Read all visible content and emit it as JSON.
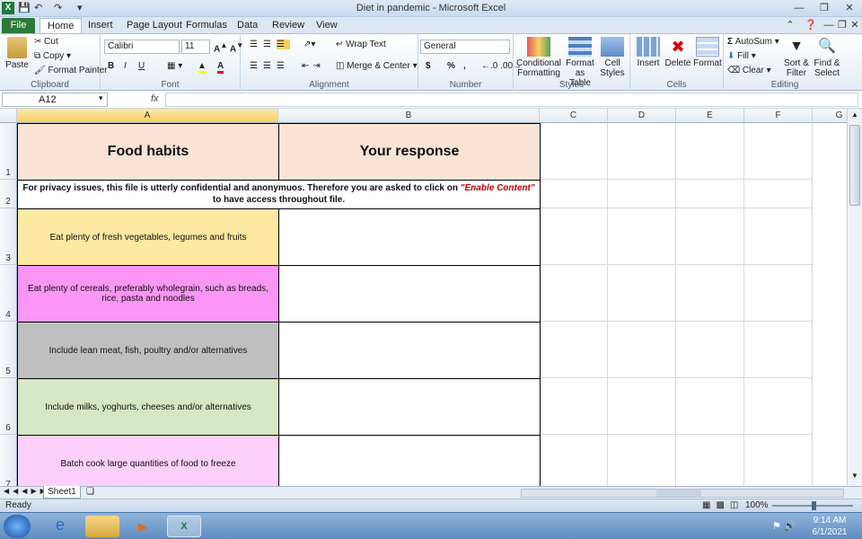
{
  "window": {
    "title": "Diet in pandemic  -  Microsoft Excel"
  },
  "tabs": [
    "File",
    "Home",
    "Insert",
    "Page Layout",
    "Formulas",
    "Data",
    "Review",
    "View"
  ],
  "active_tab": "Home",
  "clipboard": {
    "paste": "Paste",
    "cut": "Cut",
    "copy": "Copy",
    "format_painter": "Format Painter",
    "label": "Clipboard"
  },
  "font": {
    "name": "Calibri",
    "size": "11",
    "label": "Font",
    "bold": "B",
    "italic": "I",
    "underline": "U"
  },
  "alignment": {
    "wrap_text": "Wrap Text",
    "merge_center": "Merge & Center",
    "label": "Alignment"
  },
  "number": {
    "format": "General",
    "label": "Number",
    "currency": "$",
    "percent": "%",
    "comma": ","
  },
  "styles": {
    "conditional": "Conditional",
    "conditional2": "Formatting",
    "format_as": "Format",
    "format_as2": "as Table",
    "cell": "Cell",
    "cell2": "Styles",
    "label": "Styles"
  },
  "cells": {
    "insert": "Insert",
    "delete": "Delete",
    "format": "Format",
    "label": "Cells"
  },
  "editing": {
    "autosum": "AutoSum",
    "fill": "Fill",
    "clear": "Clear",
    "sort": "Sort &",
    "sort2": "Filter",
    "find": "Find &",
    "find2": "Select",
    "label": "Editing"
  },
  "formula_bar": {
    "name_box": "A12",
    "fx": "fx",
    "formula": ""
  },
  "columns": [
    "A",
    "B",
    "C",
    "D",
    "E",
    "F",
    "G"
  ],
  "rows": [
    {
      "num": "1",
      "a": "Food habits",
      "b": "Your response"
    },
    {
      "num": "2",
      "notice_pre": "For privacy issues, this file is utterly confidential and anonymuos. Therefore you are asked to click on ",
      "notice_em": "\"Enable Content\"",
      "notice_post": "  to have access throughout file."
    },
    {
      "num": "3",
      "a": "Eat plenty of fresh vegetables, legumes and fruits",
      "b": ""
    },
    {
      "num": "4",
      "a": "Eat plenty of cereals, preferably wholegrain, such as breads, rice, pasta and noodles",
      "b": ""
    },
    {
      "num": "5",
      "a": "Include lean meat, fish, poultry and/or alternatives",
      "b": ""
    },
    {
      "num": "6",
      "a": "Include milks, yoghurts, cheeses and/or alternatives",
      "b": ""
    },
    {
      "num": "7",
      "a": "Batch cook large quantities of food to freeze",
      "b": ""
    }
  ],
  "colors": {
    "header_fill": "#fbe3d6",
    "row3": "#fde9a2",
    "row4": "#fb96f6",
    "row5": "#bfbfbf",
    "row6": "#d7e7c5",
    "row7": "#fdd0fb",
    "selected_col": "#f6cf63",
    "notice_em": "#c00000"
  },
  "sheet_tab": "Sheet1",
  "status": {
    "ready": "Ready",
    "zoom": "100%"
  },
  "taskbar": {
    "time": "9:14 AM",
    "date": "6/1/2021"
  }
}
